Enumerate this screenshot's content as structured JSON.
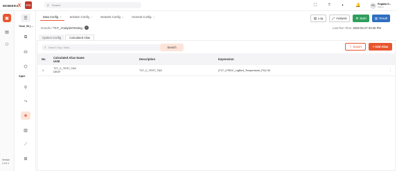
{
  "app": {
    "logo_text": "MOBIERA",
    "logo_mark": "X",
    "logo_badge": "PTC",
    "search_placeholder": "Search",
    "user": {
      "initials": "PG",
      "name": "Prajakta G...",
      "role": "Admin"
    }
  },
  "rail": {
    "version_label": "Version",
    "version": "1.0.0.1"
  },
  "subnav": {
    "project_label": "Total_53 | ...",
    "apps_label": "Apps"
  },
  "config_tabs": [
    {
      "label": "Data Config",
      "check": "✓"
    },
    {
      "label": "Solution Config",
      "check": "✓"
    },
    {
      "label": "Network Config",
      "check": "✓"
    },
    {
      "label": "General Config",
      "check": "✓"
    }
  ],
  "actions": {
    "log": "Log",
    "analysis": "Analysis",
    "build": "Build",
    "result": "Result"
  },
  "breadcrumb": {
    "root": "Details /",
    "current": "T1T_AnalysisTesting",
    "info": "i"
  },
  "last_run": {
    "label": "Last Run Time:",
    "value": "2025-04-27 03:25 PM"
  },
  "sub_tabs": [
    "System Config",
    "Calculated Alias"
  ],
  "toolbar": {
    "filter_placeholder": "Search Tag / Alias...",
    "search": "Search",
    "export": "Export",
    "add_alias": "+ Add Alias"
  },
  "table": {
    "headers": {
      "no": "No",
      "alias_name": "Calculated Alias Name",
      "uom": "UoM",
      "description": "Description",
      "expression": "Expression"
    },
    "rows": [
      {
        "no": "1",
        "alias_name": "T1T_C_TEST_TAG",
        "uom": "DEGF",
        "description": "T1T_C_TEST_TAG",
        "expression": "{T1T_LPEDC_LigBed_Temperature_PV}+34"
      }
    ]
  }
}
